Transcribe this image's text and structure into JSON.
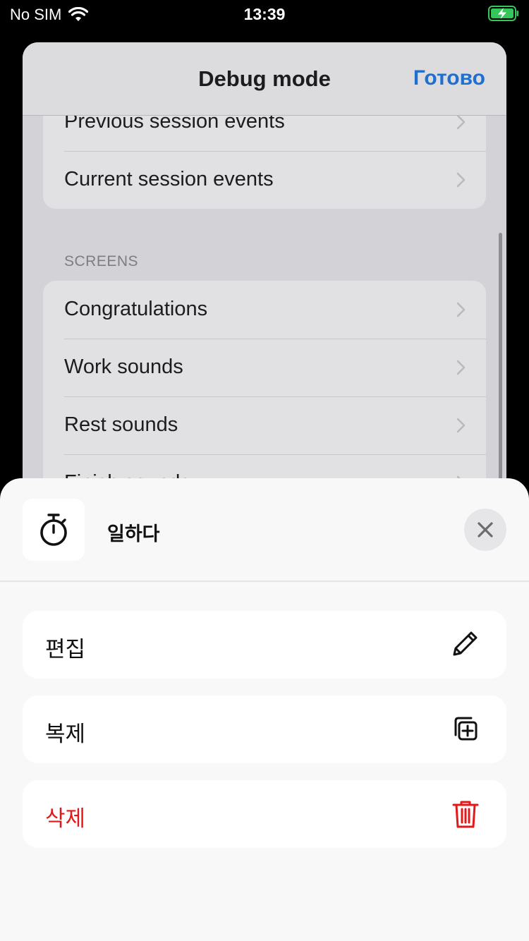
{
  "status_bar": {
    "carrier": "No SIM",
    "time": "13:39",
    "wifi_icon": "wifi-icon",
    "battery_icon": "battery-charging-icon",
    "battery_color": "#34c759"
  },
  "debug_screen": {
    "title": "Debug mode",
    "done_label": "Готово",
    "events_rows": [
      "Previous session events",
      "Current session events"
    ],
    "screens_header": "SCREENS",
    "screens_rows": [
      "Congratulations",
      "Work sounds",
      "Rest sounds",
      "Finish sounds"
    ]
  },
  "sheet": {
    "app_icon": "stopwatch-icon",
    "title": "일하다",
    "close_icon": "close-icon",
    "actions": [
      {
        "label": "편집",
        "icon": "pencil-icon",
        "destructive": false
      },
      {
        "label": "복제",
        "icon": "duplicate-icon",
        "destructive": false
      },
      {
        "label": "삭제",
        "icon": "trash-icon",
        "destructive": true
      }
    ]
  },
  "colors": {
    "accent": "#1f6fd1",
    "destructive": "#e0191b",
    "sheet_background": "#f8f8f8"
  }
}
